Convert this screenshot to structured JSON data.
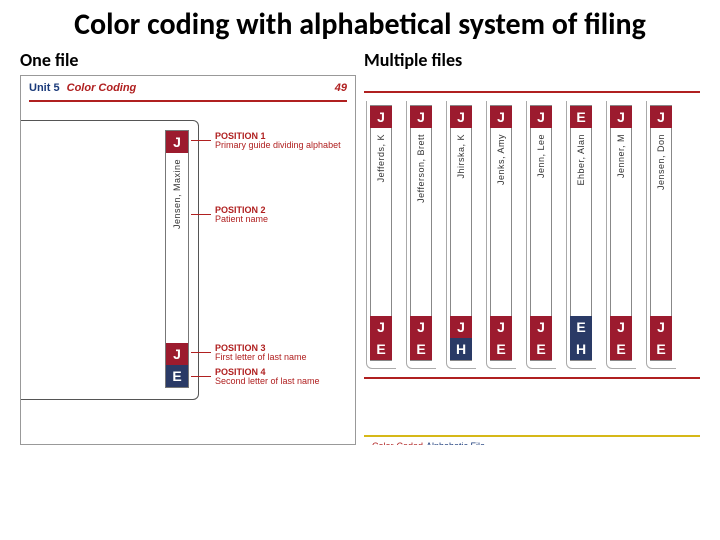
{
  "title": "Color coding with alphabetical system of filing",
  "left": {
    "heading": "One file",
    "unit": "Unit 5",
    "unit_sub": "Color Coding",
    "page": "49",
    "tab": {
      "top_letter": "J",
      "name": "Jensen, Maxine",
      "l1": "J",
      "l2": "E"
    },
    "ann": {
      "p1t": "POSITION 1",
      "p1d": "Primary guide dividing alphabet",
      "p2t": "POSITION 2",
      "p2d": "Patient name",
      "p3t": "POSITION 3",
      "p3d": "First letter of last name",
      "p4t": "POSITION 4",
      "p4d": "Second letter of last name"
    }
  },
  "right": {
    "heading": "Multiple files",
    "caption_a": "Color-Coded",
    "caption_b": "Alphabetic File",
    "tabs": [
      {
        "top": "J",
        "name": "Jefferds, K",
        "l1": "J",
        "l2": "E",
        "c1": "bg-red",
        "c2": "bg-red"
      },
      {
        "top": "J",
        "name": "Jefferson, Brett",
        "l1": "J",
        "l2": "E",
        "c1": "bg-red",
        "c2": "bg-red"
      },
      {
        "top": "J",
        "name": "Jhirska, K",
        "l1": "J",
        "l2": "H",
        "c1": "bg-red",
        "c2": "bg-navy"
      },
      {
        "top": "J",
        "name": "Jenks, Amy",
        "l1": "J",
        "l2": "E",
        "c1": "bg-red",
        "c2": "bg-red"
      },
      {
        "top": "J",
        "name": "Jenn, Lee",
        "l1": "J",
        "l2": "E",
        "c1": "bg-red",
        "c2": "bg-red"
      },
      {
        "top": "E",
        "name": "Ehber, Alan",
        "l1": "E",
        "l2": "H",
        "c1": "bg-navy",
        "c2": "bg-navy"
      },
      {
        "top": "J",
        "name": "Jenner, M",
        "l1": "J",
        "l2": "E",
        "c1": "bg-red",
        "c2": "bg-red"
      },
      {
        "top": "J",
        "name": "Jensen, Don",
        "l1": "J",
        "l2": "E",
        "c1": "bg-red",
        "c2": "bg-red"
      }
    ]
  }
}
